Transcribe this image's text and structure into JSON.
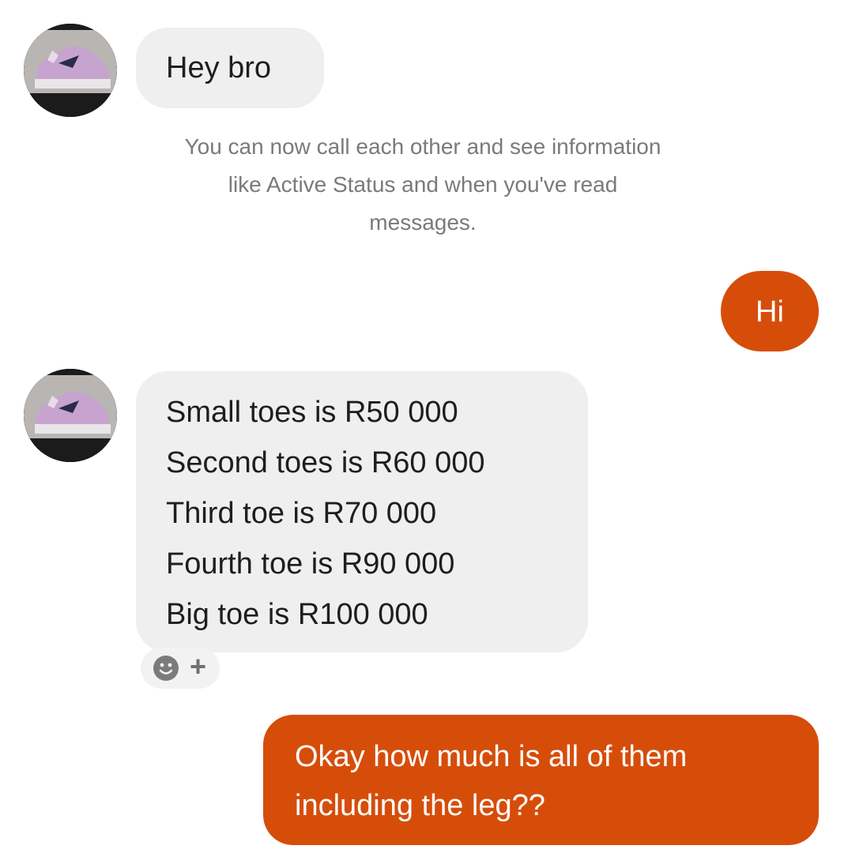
{
  "conversation": {
    "messages": [
      {
        "from": "other",
        "text": "Hey bro"
      },
      {
        "from": "system",
        "lines": [
          "You can now call each other and see information",
          "like Active Status and when you've read",
          "messages."
        ]
      },
      {
        "from": "me",
        "text": "Hi"
      },
      {
        "from": "other",
        "lines": [
          "Small toes is R50 000",
          "Second toes is R60 000",
          "Third toe is R70 000",
          "Fourth toe is R90 000",
          "Big toe is R100 000"
        ]
      },
      {
        "from": "me",
        "lines": [
          "Okay how much is all of them",
          "including the leg??"
        ]
      }
    ],
    "avatar_icon": "sneaker-avatar",
    "reaction_icons": [
      "smiley-face-icon",
      "plus-icon"
    ]
  },
  "colors": {
    "outgoing_bubble": "#d64d0a",
    "incoming_bubble": "#efefef",
    "system_text": "#7a7a7a"
  }
}
